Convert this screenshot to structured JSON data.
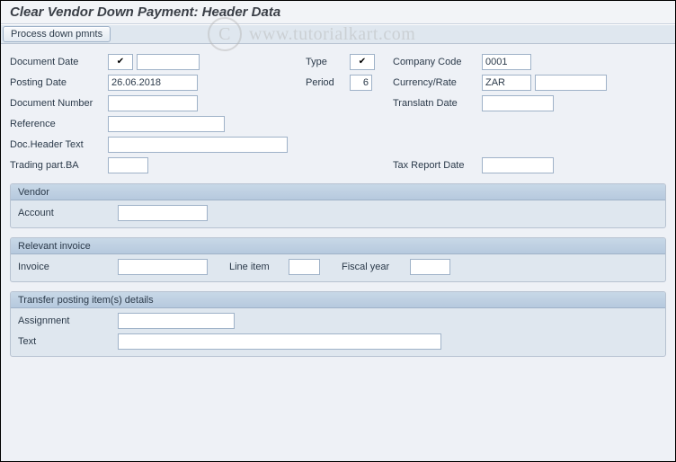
{
  "title": "Clear Vendor Down Payment: Header Data",
  "watermark": "www.tutorialkart.com",
  "toolbar": {
    "process_btn": "Process down pmnts"
  },
  "header": {
    "document_date_label": "Document Date",
    "document_date": "",
    "posting_date_label": "Posting Date",
    "posting_date": "26.06.2018",
    "document_number_label": "Document Number",
    "document_number": "",
    "reference_label": "Reference",
    "reference": "",
    "doc_header_text_label": "Doc.Header Text",
    "doc_header_text": "",
    "trading_part_ba_label": "Trading part.BA",
    "trading_part_ba": "",
    "type_label": "Type",
    "type": "",
    "period_label": "Period",
    "period": "6",
    "company_code_label": "Company Code",
    "company_code": "0001",
    "currency_rate_label": "Currency/Rate",
    "currency_rate_a": "ZAR",
    "currency_rate_b": "",
    "translatn_date_label": "Translatn Date",
    "translatn_date": "",
    "tax_report_date_label": "Tax Report Date",
    "tax_report_date": ""
  },
  "vendor": {
    "title": "Vendor",
    "account_label": "Account",
    "account": ""
  },
  "invoice": {
    "title": "Relevant invoice",
    "invoice_label": "Invoice",
    "invoice": "",
    "line_item_label": "Line item",
    "line_item": "",
    "fiscal_year_label": "Fiscal year",
    "fiscal_year": ""
  },
  "transfer": {
    "title": "Transfer posting item(s) details",
    "assignment_label": "Assignment",
    "assignment": "",
    "text_label": "Text",
    "text": ""
  }
}
